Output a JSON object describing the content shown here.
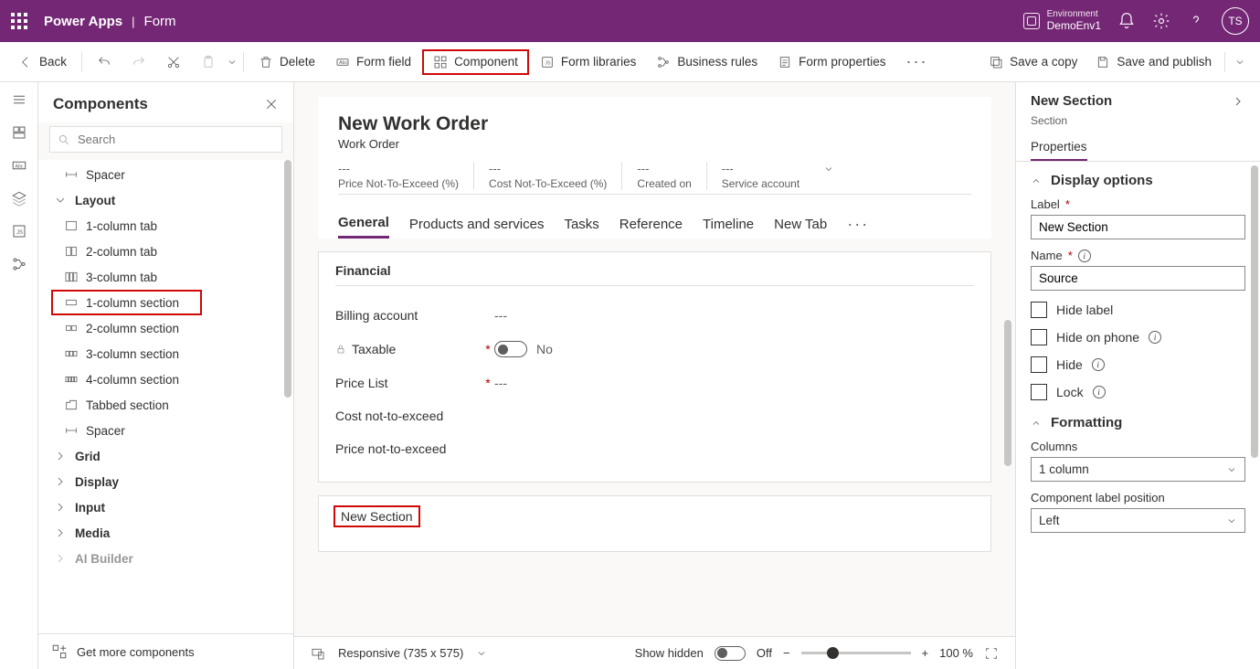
{
  "top": {
    "app": "Power Apps",
    "page": "Form",
    "env_label": "Environment",
    "env_name": "DemoEnv1",
    "avatar": "TS"
  },
  "cmd": {
    "back": "Back",
    "delete": "Delete",
    "formfield": "Form field",
    "component": "Component",
    "libraries": "Form libraries",
    "rules": "Business rules",
    "props": "Form properties",
    "savecopy": "Save a copy",
    "savepub": "Save and publish"
  },
  "panel": {
    "title": "Components",
    "search_ph": "Search",
    "footer": "Get more components",
    "items": {
      "spacer1": "Spacer",
      "layout": "Layout",
      "c1tab": "1-column tab",
      "c2tab": "2-column tab",
      "c3tab": "3-column tab",
      "c1sec": "1-column section",
      "c2sec": "2-column section",
      "c3sec": "3-column section",
      "c4sec": "4-column section",
      "tabbed": "Tabbed section",
      "spacer2": "Spacer",
      "grid": "Grid",
      "display": "Display",
      "input": "Input",
      "media": "Media",
      "ai": "AI Builder"
    }
  },
  "form": {
    "title": "New Work Order",
    "subtitle": "Work Order",
    "hdr": [
      {
        "v": "---",
        "l": "Price Not-To-Exceed (%)"
      },
      {
        "v": "---",
        "l": "Cost Not-To-Exceed (%)"
      },
      {
        "v": "---",
        "l": "Created on"
      },
      {
        "v": "---",
        "l": "Service account"
      }
    ],
    "tabs": {
      "general": "General",
      "products": "Products and services",
      "tasks": "Tasks",
      "reference": "Reference",
      "timeline": "Timeline",
      "newtab": "New Tab"
    },
    "financial": {
      "title": "Financial",
      "billing": "Billing account",
      "billing_v": "---",
      "taxable": "Taxable",
      "taxable_v": "No",
      "pricelist": "Price List",
      "pricelist_v": "---",
      "costnte": "Cost not-to-exceed",
      "pricente": "Price not-to-exceed"
    },
    "newsection": "New Section"
  },
  "status": {
    "resp": "Responsive (735 x 575)",
    "showhidden": "Show hidden",
    "off": "Off",
    "zoom": "100 %"
  },
  "props": {
    "title": "New Section",
    "sub": "Section",
    "tab": "Properties",
    "display": "Display options",
    "label_l": "Label",
    "label_v": "New Section",
    "name_l": "Name",
    "name_v": "Source",
    "hidelabel": "Hide label",
    "hidephone": "Hide on phone",
    "hide": "Hide",
    "lock": "Lock",
    "formatting": "Formatting",
    "columns_l": "Columns",
    "columns_v": "1 column",
    "clp_l": "Component label position",
    "clp_v": "Left"
  }
}
